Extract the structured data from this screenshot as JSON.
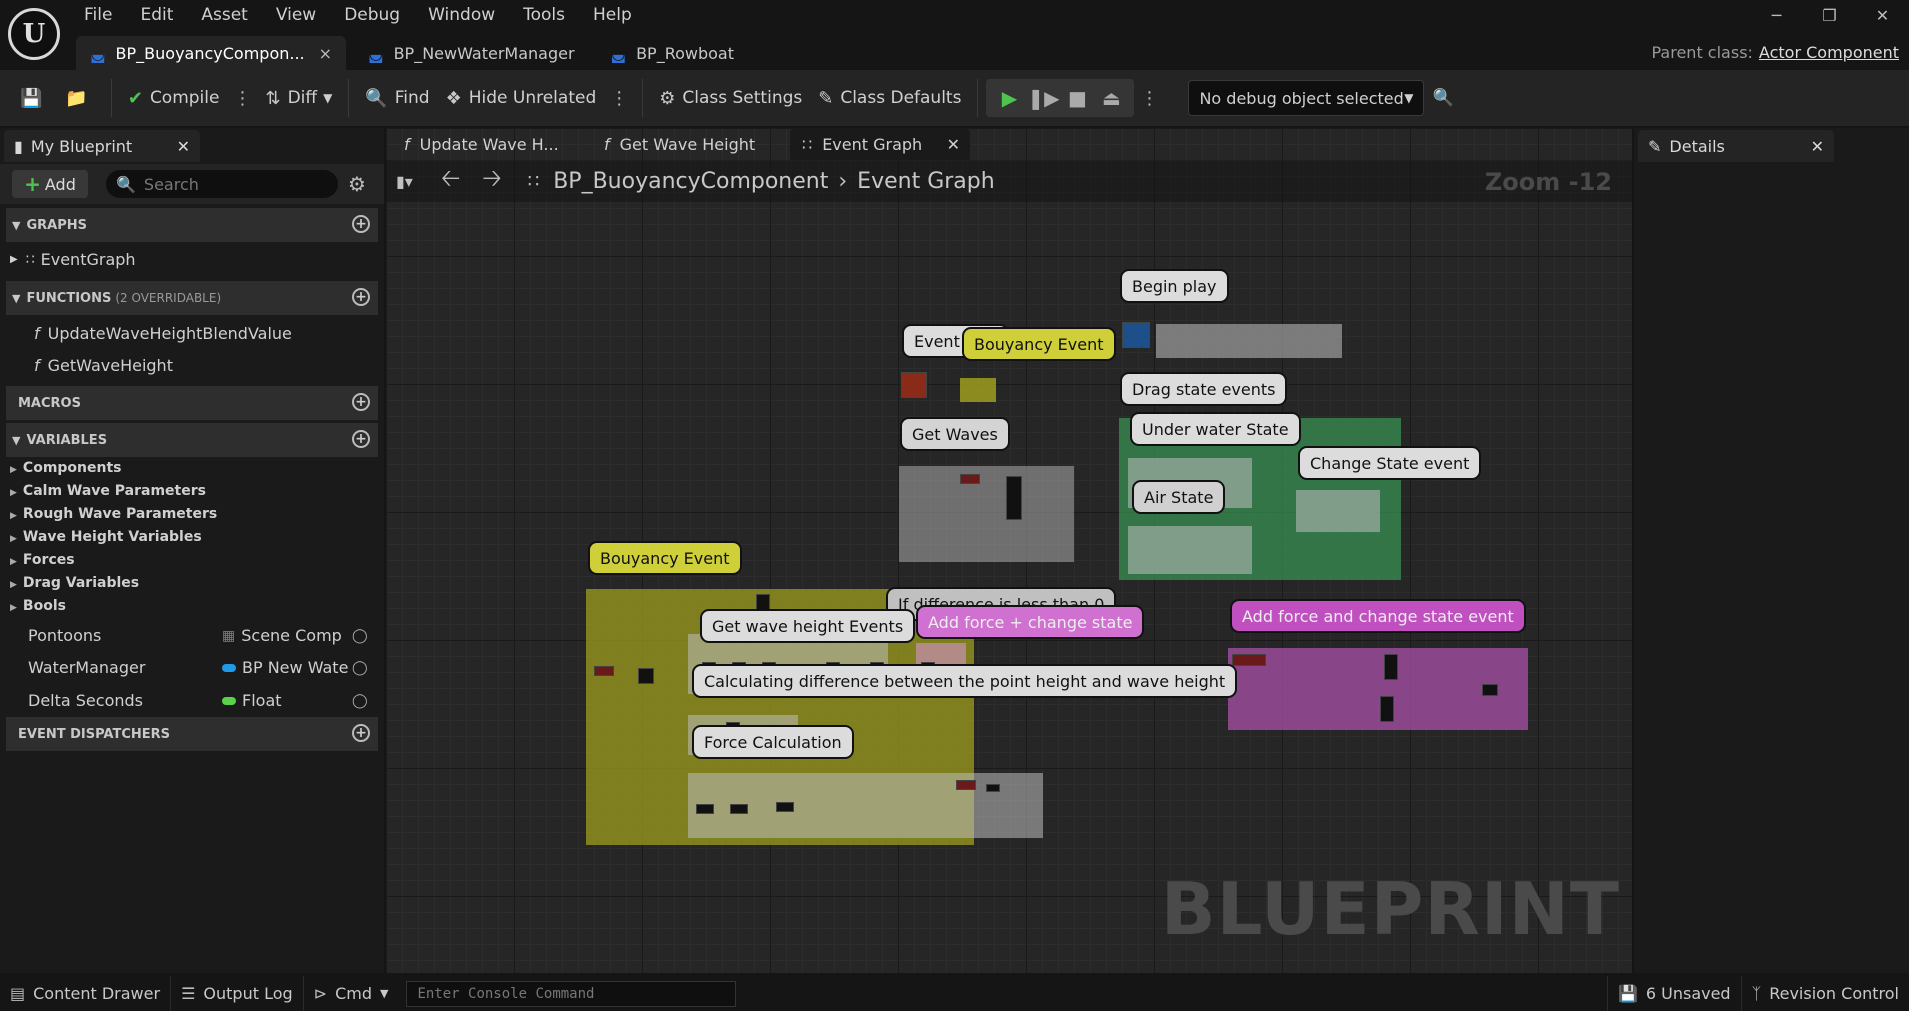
{
  "menu": [
    "File",
    "Edit",
    "Asset",
    "View",
    "Debug",
    "Window",
    "Tools",
    "Help"
  ],
  "tabs": [
    {
      "label": "BP_BuoyancyCompon...",
      "close": "×"
    },
    {
      "label": "BP_NewWaterManager"
    },
    {
      "label": "BP_Rowboat"
    }
  ],
  "parent_class": {
    "label": "Parent class:",
    "value": "Actor Component"
  },
  "window_controls": [
    "─",
    "❐",
    "✕"
  ],
  "toolbar": {
    "compile": "Compile",
    "diff": "Diff",
    "find": "Find",
    "hide_unrelated": "Hide Unrelated",
    "class_settings": "Class Settings",
    "class_defaults": "Class Defaults",
    "debug_object": "No debug object selected"
  },
  "my_blueprint": {
    "tab": "My Blueprint",
    "add": "Add",
    "search_placeholder": "Search",
    "graphs_header": "GRAPHS",
    "event_graph": "EventGraph",
    "functions_header": "FUNCTIONS",
    "functions_sub": "(2 OVERRIDABLE)",
    "functions": [
      "UpdateWaveHeightBlendValue",
      "GetWaveHeight"
    ],
    "macros_header": "MACROS",
    "variables_header": "VARIABLES",
    "categories": [
      "Components",
      "Calm Wave Parameters",
      "Rough Wave Parameters",
      "Wave Height Variables",
      "Forces",
      "Drag Variables",
      "Bools"
    ],
    "variables": [
      {
        "name": "Pontoons",
        "type": "Scene Comp",
        "color": "#3a8fd8"
      },
      {
        "name": "WaterManager",
        "type": "BP New Wate",
        "color": "#1f9be8"
      },
      {
        "name": "Delta Seconds",
        "type": "Float",
        "color": "#5ad14a"
      }
    ],
    "dispatchers_header": "EVENT DISPATCHERS"
  },
  "graph_tabs": [
    "Update Wave H...",
    "Get Wave Height",
    "Event Graph"
  ],
  "breadcrumb": {
    "blueprint": "BP_BuoyancyComponent",
    "graph": "Event Graph"
  },
  "zoom": "Zoom -12",
  "watermark": "BLUEPRINT",
  "comments": {
    "begin_play": "Begin play",
    "event_tick": "Event Tick",
    "bouyancy_top": "Bouyancy Event",
    "get_waves": "Get Waves",
    "drag_state": "Drag state events",
    "under_water": "Under water State",
    "change_state": "Change State event",
    "air_state": "Air State",
    "bouyancy_main": "Bouyancy Event",
    "if_diff": "If difference is less than 0",
    "add_force": "Add force + change state",
    "get_wave_height": "Get wave height Events",
    "calc_diff": "Calculating difference between the point height and wave height",
    "force_calc": "Force Calculation",
    "add_force_change": "Add force and change state event"
  },
  "details_tab": "Details",
  "status": {
    "content_drawer": "Content Drawer",
    "output_log": "Output Log",
    "cmd": "Cmd",
    "console_placeholder": "Enter Console Command",
    "unsaved": "6 Unsaved",
    "revision": "Revision Control"
  }
}
